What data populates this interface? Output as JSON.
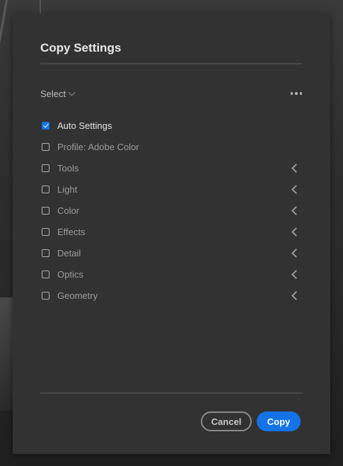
{
  "dialog": {
    "title": "Copy Settings",
    "select_label": "Select",
    "more_icon": "ellipsis-icon",
    "items": [
      {
        "label": "Auto Settings",
        "checked": true,
        "expandable": false
      },
      {
        "label": "Profile: Adobe Color",
        "checked": false,
        "expandable": false
      },
      {
        "label": "Tools",
        "checked": false,
        "expandable": true
      },
      {
        "label": "Light",
        "checked": false,
        "expandable": true
      },
      {
        "label": "Color",
        "checked": false,
        "expandable": true
      },
      {
        "label": "Effects",
        "checked": false,
        "expandable": true
      },
      {
        "label": "Detail",
        "checked": false,
        "expandable": true
      },
      {
        "label": "Optics",
        "checked": false,
        "expandable": true
      },
      {
        "label": "Geometry",
        "checked": false,
        "expandable": true
      }
    ],
    "cancel_label": "Cancel",
    "copy_label": "Copy"
  },
  "colors": {
    "accent": "#1473e6",
    "dialog_bg": "#323232"
  }
}
